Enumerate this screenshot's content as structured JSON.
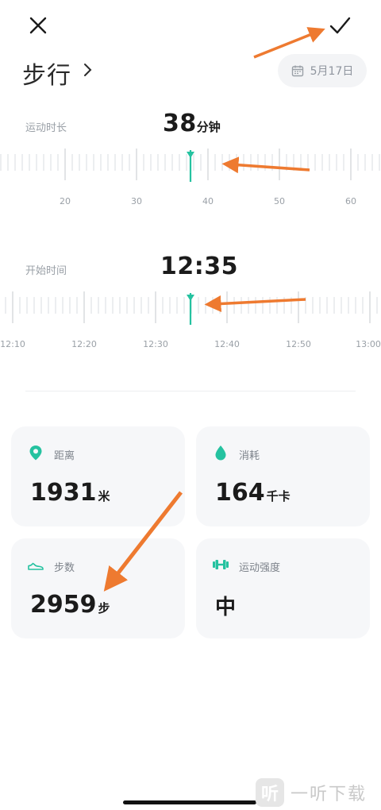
{
  "header": {
    "title": "步行",
    "date": "5月17日"
  },
  "duration": {
    "label": "运动时长",
    "value": "38",
    "unit": "分钟",
    "ruler_labels": [
      "20",
      "30",
      "40",
      "50",
      "60"
    ]
  },
  "start_time": {
    "label": "开始时间",
    "value": "12:35",
    "ruler_labels": [
      "12:10",
      "12:20",
      "12:30",
      "12:40",
      "12:50",
      "13:00"
    ]
  },
  "cards": {
    "distance": {
      "label": "距离",
      "value": "1931",
      "unit": "米"
    },
    "calories": {
      "label": "消耗",
      "value": "164",
      "unit": "千卡"
    },
    "steps": {
      "label": "步数",
      "value": "2959",
      "unit": "步"
    },
    "intensity": {
      "label": "运动强度",
      "value": "中"
    }
  },
  "watermark": {
    "text": "一听下载",
    "logo": "听"
  },
  "colors": {
    "accent": "#25c2a0",
    "annotation": "#ee7a30",
    "card_bg": "#f6f7f9"
  }
}
